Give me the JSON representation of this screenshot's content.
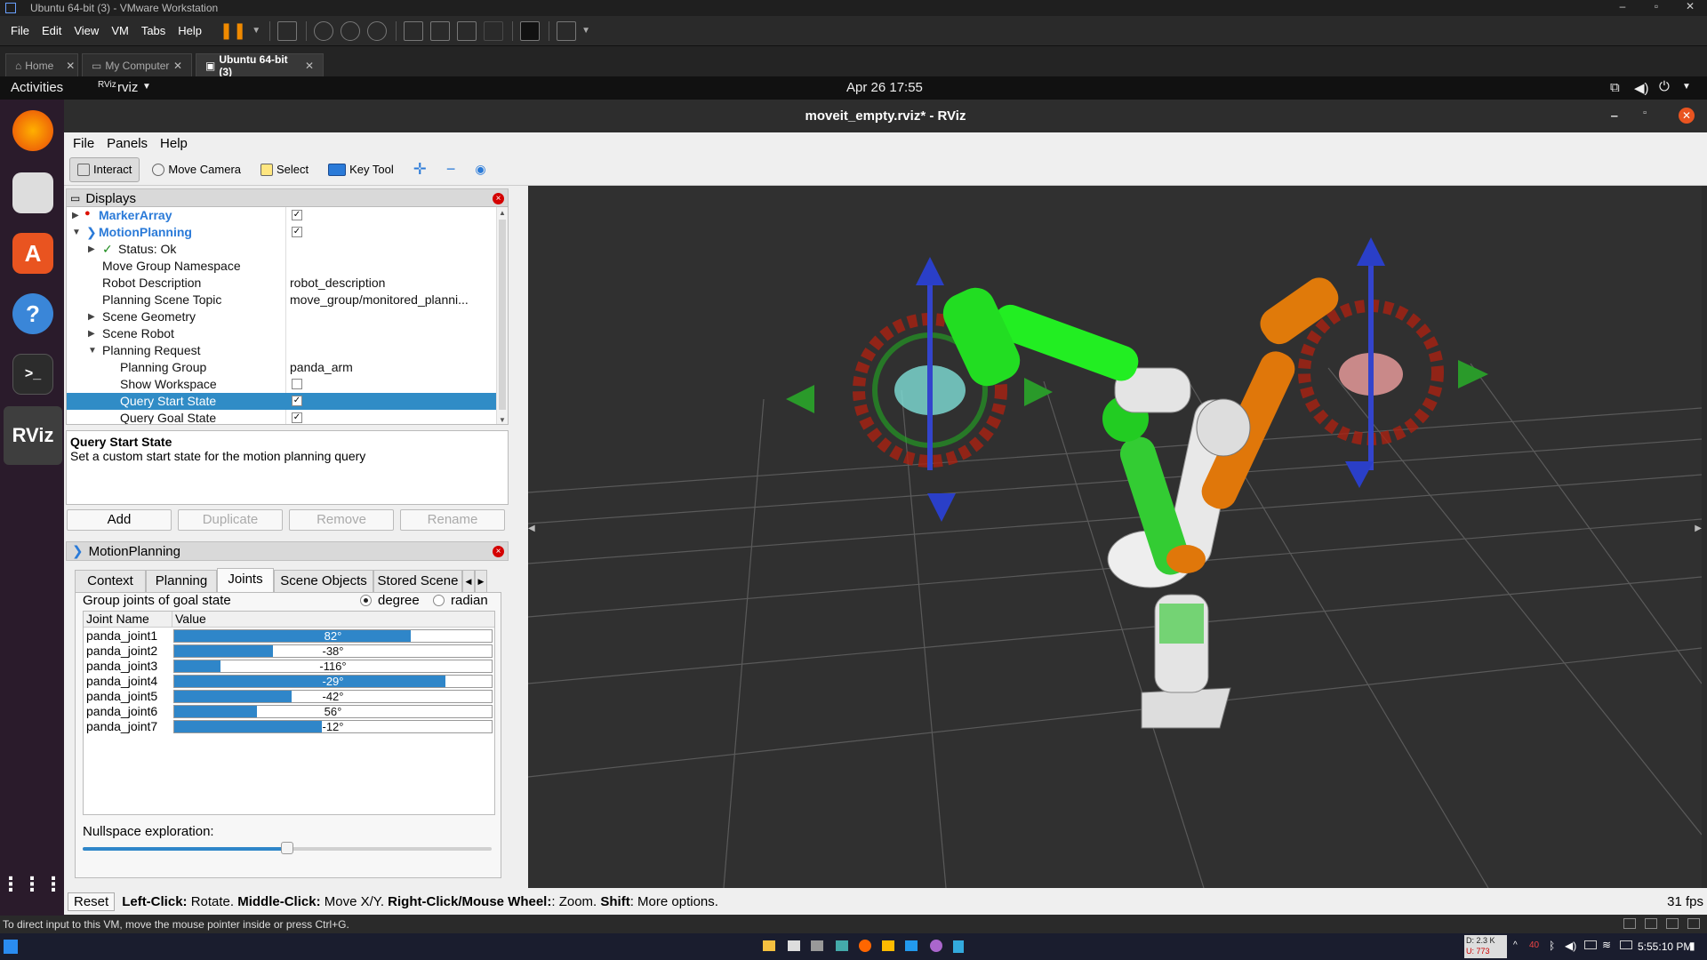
{
  "vm": {
    "title": "Ubuntu 64-bit (3) - VMware Workstation",
    "menu": [
      "File",
      "Edit",
      "View",
      "VM",
      "Tabs",
      "Help"
    ],
    "tabs": [
      {
        "label": "Home",
        "active": false
      },
      {
        "label": "My Computer",
        "active": false
      },
      {
        "label": "Ubuntu 64-bit (3)",
        "active": true
      }
    ],
    "hint": "To direct input to this VM, move the mouse pointer inside or press Ctrl+G."
  },
  "gnome": {
    "activities": "Activities",
    "app": "rviz",
    "clock": "Apr 26  17:55"
  },
  "dock": {
    "items": [
      "firefox-icon",
      "files-icon",
      "software-icon",
      "help-icon",
      "terminal-icon",
      "rviz-icon",
      "apps-grid-icon"
    ],
    "rviz_label": "RViz"
  },
  "rviz": {
    "window_title": "moveit_empty.rviz* - RViz",
    "menu": [
      "File",
      "Panels",
      "Help"
    ],
    "tools": [
      "Interact",
      "Move Camera",
      "Select",
      "Key Tool"
    ],
    "displays_title": "Displays",
    "tree": [
      {
        "key": "MarkerArray",
        "value": "",
        "check": true
      },
      {
        "key": "MotionPlanning",
        "value": "",
        "check": true
      },
      {
        "key": "Status: Ok",
        "value": ""
      },
      {
        "key": "Move Group Namespace",
        "value": ""
      },
      {
        "key": "Robot Description",
        "value": "robot_description"
      },
      {
        "key": "Planning Scene Topic",
        "value": "move_group/monitored_planni..."
      },
      {
        "key": "Scene Geometry",
        "value": ""
      },
      {
        "key": "Scene Robot",
        "value": ""
      },
      {
        "key": "Planning Request",
        "value": ""
      },
      {
        "key": "Planning Group",
        "value": "panda_arm"
      },
      {
        "key": "Show Workspace",
        "value": "",
        "check": false
      },
      {
        "key": "Query Start State",
        "value": "",
        "check": true
      },
      {
        "key": "Query Goal State",
        "value": "",
        "check": true
      }
    ],
    "desc_title": "Query Start State",
    "desc_text": "Set a custom start state for the motion planning query",
    "buttons": [
      "Add",
      "Duplicate",
      "Remove",
      "Rename"
    ],
    "mp_title": "MotionPlanning",
    "mp_tabs": [
      "Context",
      "Planning",
      "Joints",
      "Scene Objects",
      "Stored Scene"
    ],
    "group_label": "Group joints of goal state",
    "unit_degree": "degree",
    "unit_radian": "radian",
    "col_joint": "Joint Name",
    "col_value": "Value",
    "joints": [
      {
        "name": "panda_joint1",
        "value": "82°",
        "fraction": 0.745
      },
      {
        "name": "panda_joint2",
        "value": "-38°",
        "fraction": 0.31
      },
      {
        "name": "panda_joint3",
        "value": "-116°",
        "fraction": 0.145
      },
      {
        "name": "panda_joint4",
        "value": "-29°",
        "fraction": 0.855
      },
      {
        "name": "panda_joint5",
        "value": "-42°",
        "fraction": 0.37
      },
      {
        "name": "panda_joint6",
        "value": "56°",
        "fraction": 0.26
      },
      {
        "name": "panda_joint7",
        "value": "-12°",
        "fraction": 0.465
      }
    ],
    "nullspace_label": "Nullspace exploration:",
    "nullspace_fraction": 0.5,
    "reset": "Reset",
    "status": [
      {
        "b": "Left-Click:",
        "t": " Rotate. "
      },
      {
        "b": "Middle-Click:",
        "t": " Move X/Y. "
      },
      {
        "b": "Right-Click/Mouse Wheel:",
        "t": ": Zoom. "
      },
      {
        "b": "Shift",
        "t": ": More options."
      }
    ],
    "fps": "31 fps"
  },
  "taskbar": {
    "time": "5:55:10 PM",
    "net_d": "D: 2.3 K",
    "net_u": "U: 773",
    "num": "40"
  }
}
